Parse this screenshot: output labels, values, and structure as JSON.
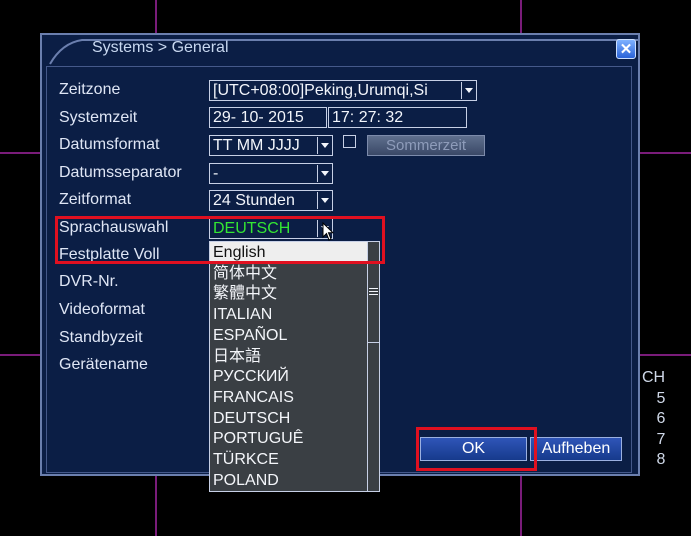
{
  "window": {
    "title": "Systems > General",
    "close_label": "✕"
  },
  "fields": {
    "zeitzone": {
      "label": "Zeitzone",
      "value": "[UTC+08:00]Peking,Urumqi,Si"
    },
    "systemzeit": {
      "label": "Systemzeit",
      "date": "29- 10- 2015",
      "time": "17: 27: 32"
    },
    "datumsformat": {
      "label": "Datumsformat",
      "value": "TT MM JJJJ"
    },
    "sommerzeit": {
      "label": "Sommerzeit"
    },
    "datumsseparator": {
      "label": "Datumsseparator",
      "value": "-"
    },
    "zeitformat": {
      "label": "Zeitformat",
      "value": "24 Stunden"
    },
    "sprachauswahl": {
      "label": "Sprachauswahl",
      "value": "DEUTSCH"
    },
    "festplatte_voll": {
      "label": "Festplatte Voll"
    },
    "dvr_nr": {
      "label": "DVR-Nr."
    },
    "videoformat": {
      "label": "Videoformat"
    },
    "standbyzeit": {
      "label": "Standbyzeit"
    },
    "geraetename": {
      "label": "Gerätename"
    }
  },
  "language_dropdown": {
    "options": [
      "English",
      "简体中文",
      "繁體中文",
      "ITALIAN",
      "ESPAÑOL",
      "日本語",
      "РУССКИЙ",
      "FRANCAIS",
      "DEUTSCH",
      "PORTUGUÊ",
      "TÜRKCE",
      "POLAND"
    ],
    "highlighted": "English"
  },
  "buttons": {
    "ok": "OK",
    "cancel": "Aufheben"
  },
  "side_panel": {
    "header": "CH",
    "channels": [
      "5",
      "6",
      "7",
      "8"
    ]
  },
  "colors": {
    "highlight_frame": "#e01020",
    "sprach_value": "#33e633",
    "dialog_bg": "#0b1e45"
  }
}
